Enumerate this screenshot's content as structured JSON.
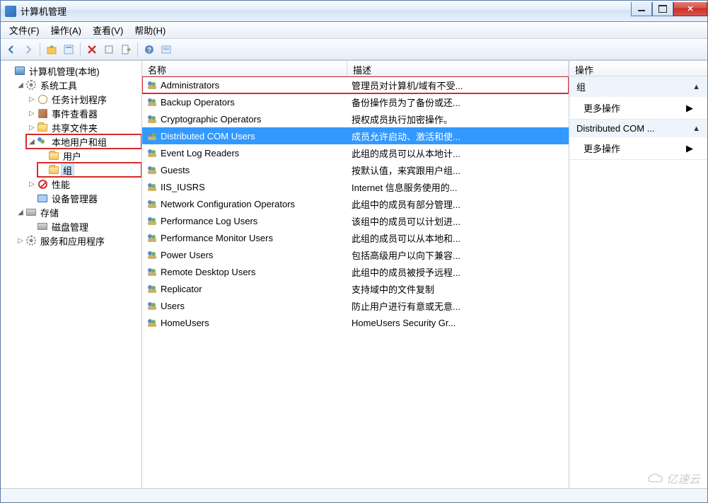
{
  "window": {
    "title": "计算机管理"
  },
  "menubar": [
    {
      "label": "文件(F)"
    },
    {
      "label": "操作(A)"
    },
    {
      "label": "查看(V)"
    },
    {
      "label": "帮助(H)"
    }
  ],
  "toolbar_icons": [
    "back-icon",
    "forward-icon",
    "up-icon",
    "props-icon",
    "delete-icon",
    "copy-icon",
    "export-icon",
    "help-icon",
    "details-icon"
  ],
  "tree": {
    "root": "计算机管理(本地)",
    "sys_tools": "系统工具",
    "task_sched": "任务计划程序",
    "event_viewer": "事件查看器",
    "shared": "共享文件夹",
    "local_users_groups": "本地用户和组",
    "users": "用户",
    "groups": "组",
    "perf": "性能",
    "dev_mgr": "设备管理器",
    "storage": "存储",
    "disk_mgmt": "磁盘管理",
    "services_apps": "服务和应用程序"
  },
  "list": {
    "col_name": "名称",
    "col_desc": "描述",
    "rows": [
      {
        "name": "Administrators",
        "desc": "管理员对计算机/域有不受...",
        "hl": "red"
      },
      {
        "name": "Backup Operators",
        "desc": "备份操作员为了备份或还..."
      },
      {
        "name": "Cryptographic Operators",
        "desc": "授权成员执行加密操作。"
      },
      {
        "name": "Distributed COM Users",
        "desc": "成员允许启动、激活和使...",
        "selected": true
      },
      {
        "name": "Event Log Readers",
        "desc": "此组的成员可以从本地计..."
      },
      {
        "name": "Guests",
        "desc": "按默认值，来宾跟用户组..."
      },
      {
        "name": "IIS_IUSRS",
        "desc": "Internet 信息服务使用的..."
      },
      {
        "name": "Network Configuration Operators",
        "desc": "此组中的成员有部分管理..."
      },
      {
        "name": "Performance Log Users",
        "desc": "该组中的成员可以计划进..."
      },
      {
        "name": "Performance Monitor Users",
        "desc": "此组的成员可以从本地和..."
      },
      {
        "name": "Power Users",
        "desc": "包括高级用户以向下兼容..."
      },
      {
        "name": "Remote Desktop Users",
        "desc": "此组中的成员被授予远程..."
      },
      {
        "name": "Replicator",
        "desc": "支持域中的文件复制"
      },
      {
        "name": "Users",
        "desc": "防止用户进行有意或无意..."
      },
      {
        "name": "HomeUsers",
        "desc": "HomeUsers Security Gr..."
      }
    ]
  },
  "actions": {
    "title": "操作",
    "section1": {
      "head": "组",
      "item": "更多操作"
    },
    "section2": {
      "head": "Distributed COM ...",
      "item": "更多操作"
    }
  },
  "watermark": "亿速云"
}
